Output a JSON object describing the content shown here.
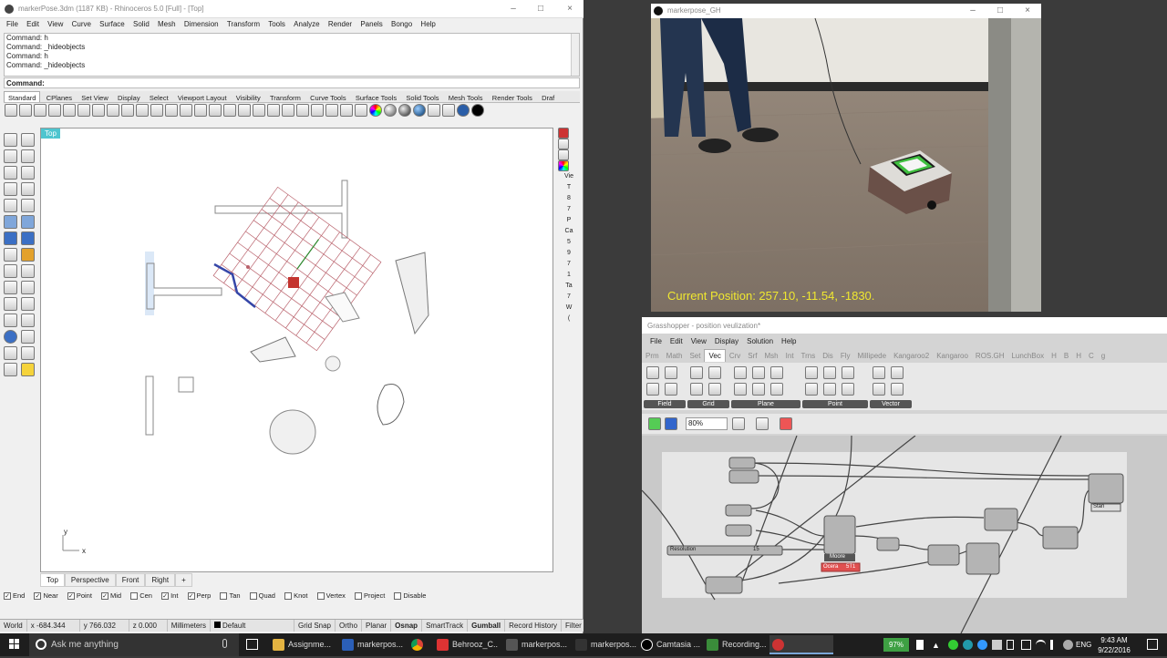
{
  "rhino": {
    "title": "markerPose.3dm (1187 KB) - Rhinoceros 5.0 [Full] - [Top]",
    "menu": [
      "File",
      "Edit",
      "View",
      "Curve",
      "Surface",
      "Solid",
      "Mesh",
      "Dimension",
      "Transform",
      "Tools",
      "Analyze",
      "Render",
      "Panels",
      "Bongo",
      "Help"
    ],
    "history": [
      "Command: h",
      "Command: _hideobjects",
      "Command: h",
      "Command: _hideobjects"
    ],
    "command_prompt": "Command:",
    "toolbar_tabs": [
      "Standard",
      "CPlanes",
      "Set View",
      "Display",
      "Select",
      "Viewport Layout",
      "Visibility",
      "Transform",
      "Curve Tools",
      "Surface Tools",
      "Solid Tools",
      "Mesh Tools",
      "Render Tools",
      "Draf"
    ],
    "viewport_label": "Top",
    "axis_x": "x",
    "axis_y": "y",
    "view_tabs": [
      "Top",
      "Perspective",
      "Front",
      "Right"
    ],
    "add_tab": "+",
    "right_panel": [
      "Vie",
      "T",
      "8",
      "7",
      "P",
      "Ca",
      "5",
      "9",
      "7",
      "1",
      "Ta",
      "7",
      "W",
      "("
    ],
    "osnaps": [
      {
        "label": "End",
        "checked": true
      },
      {
        "label": "Near",
        "checked": true
      },
      {
        "label": "Point",
        "checked": true
      },
      {
        "label": "Mid",
        "checked": true
      },
      {
        "label": "Cen",
        "checked": false
      },
      {
        "label": "Int",
        "checked": true
      },
      {
        "label": "Perp",
        "checked": true
      },
      {
        "label": "Tan",
        "checked": false
      },
      {
        "label": "Quad",
        "checked": false
      },
      {
        "label": "Knot",
        "checked": false
      },
      {
        "label": "Vertex",
        "checked": false
      },
      {
        "label": "Project",
        "checked": false
      },
      {
        "label": "Disable",
        "checked": false
      }
    ],
    "status": {
      "cplane": "World",
      "x": "x -684.344",
      "y": "y 766.032",
      "z": "z 0.000",
      "units": "Millimeters",
      "layer": "Default",
      "grid_snap": "Grid Snap",
      "ortho": "Ortho",
      "planar": "Planar",
      "osnap": "Osnap",
      "smarttrack": "SmartTrack",
      "gumball": "Gumball",
      "record_history": "Record History",
      "filter": "Filter"
    }
  },
  "video": {
    "title": "markerpose_GH",
    "position_text": "Current Position: 257.10, -11.54, -1830."
  },
  "grasshopper": {
    "title": "Grasshopper - position veulization*",
    "menu": [
      "File",
      "Edit",
      "View",
      "Display",
      "Solution",
      "Help"
    ],
    "tabs": [
      "Prm",
      "Math",
      "Set",
      "Vec",
      "Crv",
      "Srf",
      "Msh",
      "Int",
      "Trns",
      "Dis",
      "Fly",
      "Millipede",
      "Kangaroo2",
      "Kangaroo",
      "ROS.GH",
      "LunchBox",
      "H",
      "B",
      "H",
      "C",
      "g"
    ],
    "active_tab": "Vec",
    "ribbon_groups": [
      "Field",
      "Grid",
      "Plane",
      "Point",
      "Vector"
    ],
    "zoom": "80%",
    "nodes": {
      "resolution": "Resolution",
      "resolution_val": "15",
      "moore": "Moore",
      "panel_a": "Ocera",
      "panel_b": "5T1",
      "out_label": "Stan"
    }
  },
  "taskbar": {
    "search_placeholder": "Ask me anything",
    "tasks": [
      "Assignme...",
      "markerpos...",
      "Behrooz_C...",
      "markerpos...",
      "markerpos...",
      "Camtasia ...",
      "Recording..."
    ],
    "battery": "97%",
    "language": "ENG",
    "time": "9:43 AM",
    "date": "9/22/2016"
  }
}
